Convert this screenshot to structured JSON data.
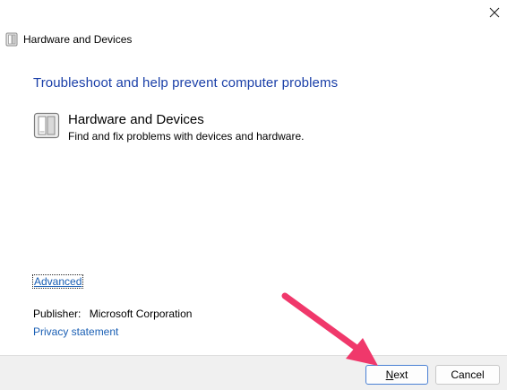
{
  "window": {
    "title": "Hardware and Devices",
    "close_icon": "close-icon"
  },
  "main": {
    "heading": "Troubleshoot and help prevent computer problems",
    "item": {
      "icon": "hardware-devices-icon",
      "title": "Hardware and Devices",
      "description": "Find and fix problems with devices and hardware."
    },
    "advanced_label": "Advanced",
    "publisher_label": "Publisher:",
    "publisher_value": "Microsoft Corporation",
    "privacy_label": "Privacy statement"
  },
  "footer": {
    "next_mnemonic": "N",
    "next_rest": "ext",
    "cancel_label": "Cancel"
  },
  "annotation": {
    "arrow_color": "#f0386b",
    "arrow_target": "next-button"
  },
  "colors": {
    "heading": "#1a3fa8",
    "link": "#1a5fb4",
    "footer_bg": "#f0f0f0"
  }
}
